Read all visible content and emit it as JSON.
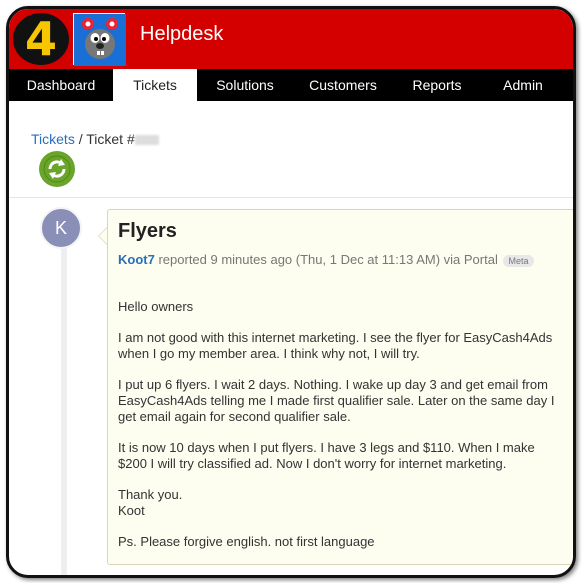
{
  "header": {
    "logo_text": "4",
    "title": "Helpdesk",
    "brand_color": "#d40000"
  },
  "nav": {
    "items": [
      {
        "label": "Dashboard"
      },
      {
        "label": "Tickets"
      },
      {
        "label": "Solutions"
      },
      {
        "label": "Customers"
      },
      {
        "label": "Reports"
      },
      {
        "label": "Admin"
      }
    ],
    "active": "Tickets"
  },
  "breadcrumb": {
    "parent": "Tickets",
    "separator": "/",
    "current_prefix": "Ticket #"
  },
  "status_icon": "refresh-icon",
  "thread": {
    "avatar_initial": "K",
    "title": "Flyers",
    "author": "Koot7",
    "meta_text": "reported 9 minutes ago (Thu, 1 Dec at 11:13 AM) via Portal",
    "meta_tag": "Meta",
    "body": [
      "Hello owners",
      "I am not good with this internet marketing. I see the flyer for EasyCash4Ads when I go my member area. I think why not, I will try.",
      "I put up 6 flyers. I wait 2 days. Nothing. I wake up day 3 and get email from EasyCash4Ads telling me I made first qualifier sale. Later on the same day I get email again for second qualifier sale.",
      "It is now 10 days when I put flyers. I have 3 legs and $110. When I make $200 I will try classified ad. Now I don't worry for internet marketing.",
      "Thank you.",
      "Koot",
      "Ps. Please forgive english. not first language"
    ]
  }
}
